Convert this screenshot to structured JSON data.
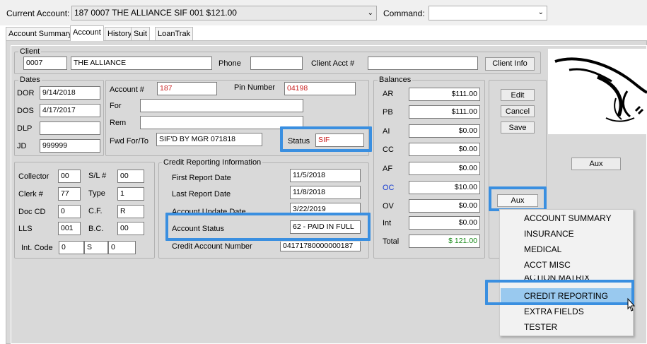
{
  "top": {
    "current_account_label": "Current Account:",
    "current_account_value": "187 0007 THE ALLIANCE SIF 001 $121.00",
    "command_label": "Command:",
    "command_value": ""
  },
  "tabs": [
    "Account Summary",
    "Account",
    "History",
    "Suit",
    "LoanTrak"
  ],
  "client": {
    "title": "Client",
    "code": "0007",
    "name": "THE ALLIANCE",
    "phone_label": "Phone",
    "phone_value": "",
    "client_acct_label": "Client Acct #",
    "client_acct_value": "",
    "client_info_button": "Client Info"
  },
  "dates": {
    "title": "Dates",
    "dor_label": "DOR",
    "dor_value": "9/14/2018",
    "dos_label": "DOS",
    "dos_value": "4/17/2017",
    "dlp_label": "DLP",
    "dlp_value": "",
    "jd_label": "JD",
    "jd_value": "999999"
  },
  "account": {
    "account_label": "Account #",
    "account_value": "187",
    "pin_label": "Pin Number",
    "pin_value": "04198",
    "for_label": "For",
    "for_value": "",
    "rem_label": "Rem",
    "rem_value": "",
    "fwd_label": "Fwd For/To",
    "fwd_value": "SIF'D BY MGR 071818",
    "status_label": "Status",
    "status_value": "SIF"
  },
  "misc": {
    "collector_label": "Collector",
    "collector_value": "00",
    "sl_label": "S/L #",
    "sl_value": "00",
    "clerk_label": "Clerk #",
    "clerk_value": "77",
    "type_label": "Type",
    "type_value": "1",
    "doccd_label": "Doc CD",
    "doccd_value": "0",
    "cf_label": "C.F.",
    "cf_value": "R",
    "lls_label": "LLS",
    "lls_value": "001",
    "bc_label": "B.C.",
    "bc_value": "00",
    "intcode_label": "Int. Code",
    "intcode_1": "0",
    "intcode_2": "S",
    "intcode_3": "0"
  },
  "credit": {
    "title": "Credit Reporting Information",
    "first_label": "First Report Date",
    "first_value": "11/5/2018",
    "last_label": "Last Report Date",
    "last_value": "11/8/2018",
    "update_label": "Account Update Date",
    "update_value": "3/22/2019",
    "status_label": "Account Status",
    "status_value": "62 - PAID IN FULL",
    "credit_num_label": "Credit Account Number",
    "credit_num_value": "04171780000000187"
  },
  "balances": {
    "title": "Balances",
    "rows": [
      {
        "label": "AR",
        "value": "$111.00"
      },
      {
        "label": "PB",
        "value": "$111.00"
      },
      {
        "label": "AI",
        "value": "$0.00"
      },
      {
        "label": "CC",
        "value": "$0.00"
      },
      {
        "label": "AF",
        "value": "$0.00"
      },
      {
        "label": "OC",
        "value": "$10.00"
      },
      {
        "label": "OV",
        "value": "$0.00"
      },
      {
        "label": "Int",
        "value": "$0.00"
      },
      {
        "label": "Total",
        "value": "$ 121.00"
      }
    ]
  },
  "actions": {
    "edit": "Edit",
    "cancel": "Cancel",
    "save": "Save",
    "aux": "Aux",
    "aux_right": "Aux"
  },
  "aux_menu": [
    "INSURANCE",
    "MEDICAL",
    "ACCT MISC",
    "ACTION MATRIX",
    "CREDIT REPORTING",
    "EXTRA FIELDS",
    "TESTER"
  ],
  "aux_menu_top": "ACCOUNT SUMMARY",
  "colors": {
    "highlight": "#3a8fe0",
    "menu_selected": "#99c9ef",
    "red_text": "#c81e1e",
    "green_text": "#1a8a1a",
    "oc_label": "#1a3fd1"
  },
  "icons": [
    "chevron-down-icon",
    "mouse-cursor-icon",
    "client-logo"
  ]
}
